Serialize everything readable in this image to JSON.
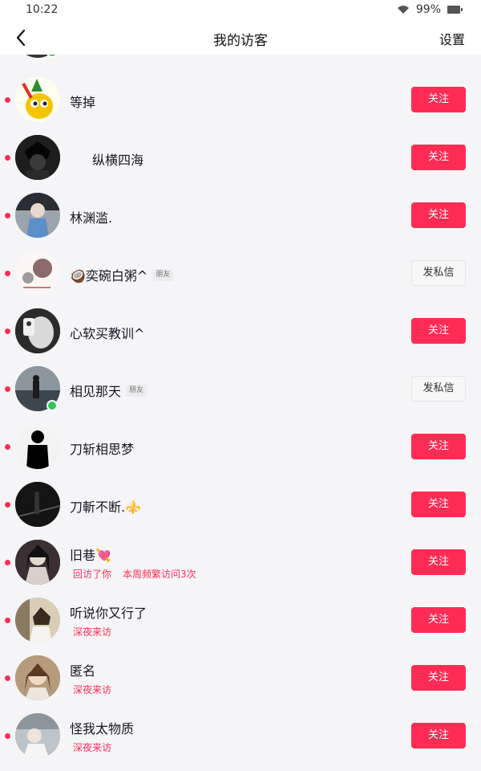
{
  "status_bar": {
    "time": "10:22",
    "battery": "99%"
  },
  "nav": {
    "back_icon": "chevron-left-icon",
    "title": "我的访客",
    "settings": "设置"
  },
  "labels": {
    "follow": "关注",
    "message": "发私信",
    "friend_tag": "朋友"
  },
  "colors": {
    "accent": "#fe2c55",
    "online": "#2fc55a"
  },
  "visitors": [
    {
      "name": "等掉",
      "action": "follow"
    },
    {
      "name": "纵横四海",
      "action": "follow"
    },
    {
      "name": "林渊滥.",
      "action": "follow"
    },
    {
      "name": "🥥奕碗白粥^",
      "action": "message",
      "friend": true
    },
    {
      "name": "心软买教训^",
      "action": "follow"
    },
    {
      "name": "相见那天",
      "action": "message",
      "friend": true,
      "online": true
    },
    {
      "name": "刀斩相思梦",
      "action": "follow"
    },
    {
      "name": "刀斬不断.⚜️",
      "action": "follow"
    },
    {
      "name": "旧巷💘",
      "action": "follow",
      "subs": [
        "回访了你",
        "本周频繁访问3次"
      ]
    },
    {
      "name": "听说你又行了",
      "action": "follow",
      "subs": [
        "深夜来访"
      ]
    },
    {
      "name": "匿名",
      "action": "follow",
      "subs": [
        "深夜来访"
      ]
    },
    {
      "name": "怪我太物质",
      "action": "follow",
      "subs": [
        "深夜来访"
      ]
    }
  ]
}
